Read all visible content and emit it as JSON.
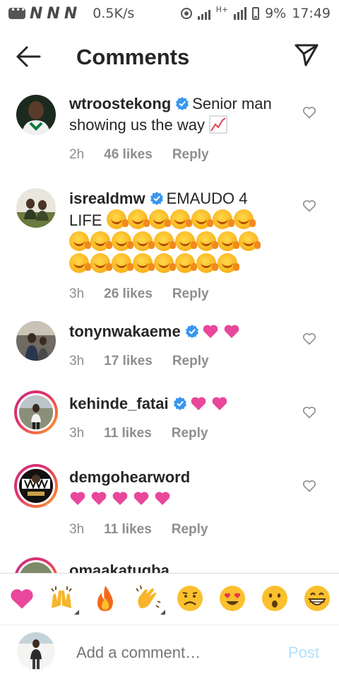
{
  "status_bar": {
    "network_speed": "0.5K/s",
    "network_type": "H+",
    "battery": "9%",
    "time": "17:49"
  },
  "header": {
    "title": "Comments",
    "back_icon": "arrow-left-icon",
    "send_icon": "paper-plane-icon"
  },
  "comments": [
    {
      "username": "wtroostekong",
      "verified": true,
      "text_line1": "Senior man",
      "text_line2": "showing us the way",
      "time": "2h",
      "likes": "46 likes",
      "reply": "Reply"
    },
    {
      "username": "isrealdmw",
      "verified": true,
      "text_line1": "EMAUDO 4",
      "text_line2": "LIFE",
      "emoji_name": "hot-face-emoji",
      "emoji_count": 22,
      "time": "3h",
      "likes": "26 likes",
      "reply": "Reply"
    },
    {
      "username": "tonynwakaeme",
      "verified": true,
      "emoji_name": "pink-heart-emoji",
      "emoji_count": 2,
      "time": "3h",
      "likes": "17 likes",
      "reply": "Reply"
    },
    {
      "username": "kehinde_fatai",
      "verified": true,
      "emoji_name": "pink-heart-emoji",
      "emoji_count": 2,
      "time": "3h",
      "likes": "11 likes",
      "reply": "Reply"
    },
    {
      "username": "demgohearword",
      "verified": false,
      "emoji_name": "pink-heart-emoji",
      "emoji_count": 5,
      "time": "3h",
      "likes": "11 likes",
      "reply": "Reply"
    },
    {
      "username": "omaakatugba"
    }
  ],
  "quick_emojis": [
    "red-heart-emoji",
    "raising-hands-emoji",
    "fire-emoji",
    "clapping-hands-emoji",
    "sad-face-emoji",
    "heart-eyes-emoji",
    "surprised-face-emoji",
    "grinning-face-emoji"
  ],
  "comment_input": {
    "placeholder": "Add a comment…",
    "post_label": "Post"
  },
  "colors": {
    "verified_blue": "#3897f0",
    "heart_pink": "#e8479b",
    "post_disabled": "#b2dffc",
    "muted_text": "#8e8e8e"
  }
}
